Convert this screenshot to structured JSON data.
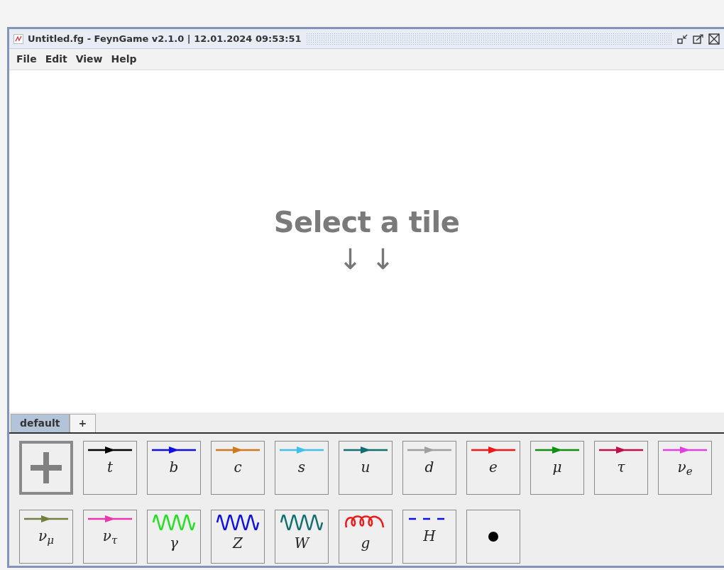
{
  "window": {
    "title": "Untitled.fg - FeynGame v2.1.0 | 12.01.2024 09:53:51"
  },
  "menu": [
    "File",
    "Edit",
    "View",
    "Help"
  ],
  "canvas": {
    "heading": "Select a tile",
    "arrows": "↓ ↓"
  },
  "tabs": [
    {
      "label": "default",
      "selected": true
    },
    {
      "label": "+",
      "selected": false
    }
  ],
  "tiles": [
    {
      "kind": "add",
      "selected": true
    },
    {
      "kind": "fermion",
      "label": "t",
      "color": "#000000"
    },
    {
      "kind": "fermion",
      "label": "b",
      "color": "#1010e0"
    },
    {
      "kind": "fermion",
      "label": "c",
      "color": "#d07a20"
    },
    {
      "kind": "fermion",
      "label": "s",
      "color": "#40c0ec"
    },
    {
      "kind": "fermion",
      "label": "u",
      "color": "#107070"
    },
    {
      "kind": "fermion",
      "label": "d",
      "color": "#a0a0a0"
    },
    {
      "kind": "fermion",
      "label": "e",
      "color": "#f01818"
    },
    {
      "kind": "fermion",
      "label": "μ",
      "color": "#109010"
    },
    {
      "kind": "fermion",
      "label": "τ",
      "color": "#c0104a"
    },
    {
      "kind": "fermion",
      "label": "ν$_{e}$",
      "color": "#e040e0"
    },
    {
      "kind": "fermion",
      "label": "ν$_{μ}$",
      "color": "#708040"
    },
    {
      "kind": "fermion",
      "label": "ν$_{τ}$",
      "color": "#e838b0"
    },
    {
      "kind": "photon",
      "label": "γ",
      "color": "#20e020"
    },
    {
      "kind": "photon",
      "label": "Z",
      "color": "#1010e0"
    },
    {
      "kind": "photon",
      "label": "W",
      "color": "#107070"
    },
    {
      "kind": "gluon",
      "label": "g",
      "color": "#f01818"
    },
    {
      "kind": "scalar",
      "label": "H",
      "color": "#1010e0"
    },
    {
      "kind": "vertex",
      "color": "#000000"
    }
  ]
}
